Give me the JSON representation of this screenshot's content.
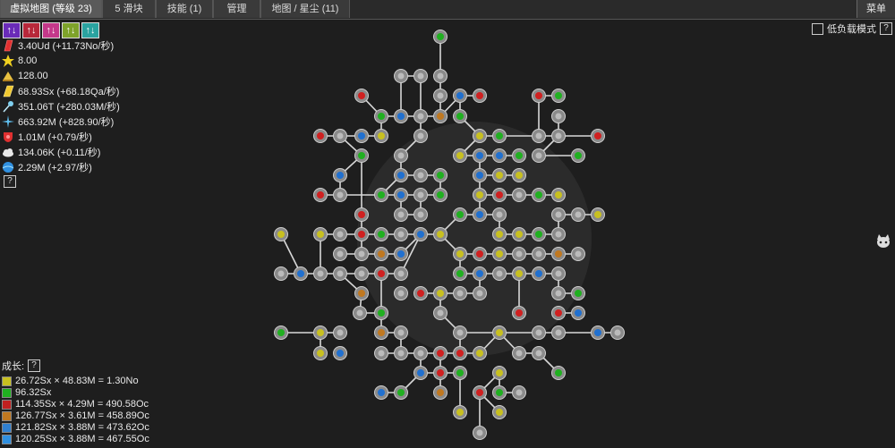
{
  "tabs": [
    {
      "label": "虚拟地图 (等级 23)",
      "active": true
    },
    {
      "label": "5 滑块",
      "active": false
    },
    {
      "label": "技能 (1)",
      "active": false
    },
    {
      "label": "管理",
      "active": false
    },
    {
      "label": "地图 / 星尘 (11)",
      "active": false
    }
  ],
  "menu_label": "菜单",
  "swatches": [
    {
      "color": "#6a2bb8",
      "glyph": "↑↓"
    },
    {
      "color": "#b8283a",
      "glyph": "↑↓"
    },
    {
      "color": "#c4388a",
      "glyph": "↑↓"
    },
    {
      "color": "#7ea32a",
      "glyph": "↑↓"
    },
    {
      "color": "#2aa3a0",
      "glyph": "↑↓"
    }
  ],
  "resources": [
    {
      "icon": "red-bar-icon",
      "color": "#e23030",
      "text": "3.40Ud (+11.73No/秒)"
    },
    {
      "icon": "star-icon",
      "color": "#f0d020",
      "text": "8.00"
    },
    {
      "icon": "pile-icon",
      "color": "#e8c040",
      "text": "128.00"
    },
    {
      "icon": "gold-bar-icon",
      "color": "#f0c830",
      "text": "68.93Sx (+68.18Qa/秒)"
    },
    {
      "icon": "wand-icon",
      "color": "#80d0f0",
      "text": "351.06T (+280.03M/秒)"
    },
    {
      "icon": "sparkle-icon",
      "color": "#60c0f0",
      "text": "663.92M (+828.90/秒)"
    },
    {
      "icon": "shield-icon",
      "color": "#e03030",
      "text": "1.01M (+0.79/秒)"
    },
    {
      "icon": "cloud-icon",
      "color": "#e8e8e8",
      "text": "134.06K (+0.11/秒)"
    },
    {
      "icon": "planet-icon",
      "color": "#3090e0",
      "text": "2.29M (+2.97/秒)"
    }
  ],
  "help_glyph": "?",
  "low_load_label": "低负载模式",
  "growth": {
    "title": "成长:",
    "rows": [
      {
        "color": "#c8c020",
        "text": "26.72Sx × 48.83M = 1.30No"
      },
      {
        "color": "#20b020",
        "text": "96.32Sx"
      },
      {
        "color": "#c02020",
        "text": "114.35Sx × 4.29M = 490.58Oc"
      },
      {
        "color": "#c07820",
        "text": "126.77Sx × 3.61M = 458.89Oc"
      },
      {
        "color": "#3080d0",
        "text": "121.82Sx × 3.88M = 473.62Oc"
      },
      {
        "color": "#3090e0",
        "text": "120.25Sx × 3.88M = 467.55Oc"
      }
    ]
  },
  "node_colors": {
    "g": "#20b020",
    "r": "#d02020",
    "b": "#2070d0",
    "y": "#c8c020",
    "o": "#c07820",
    "w": "#bbbbbb"
  }
}
